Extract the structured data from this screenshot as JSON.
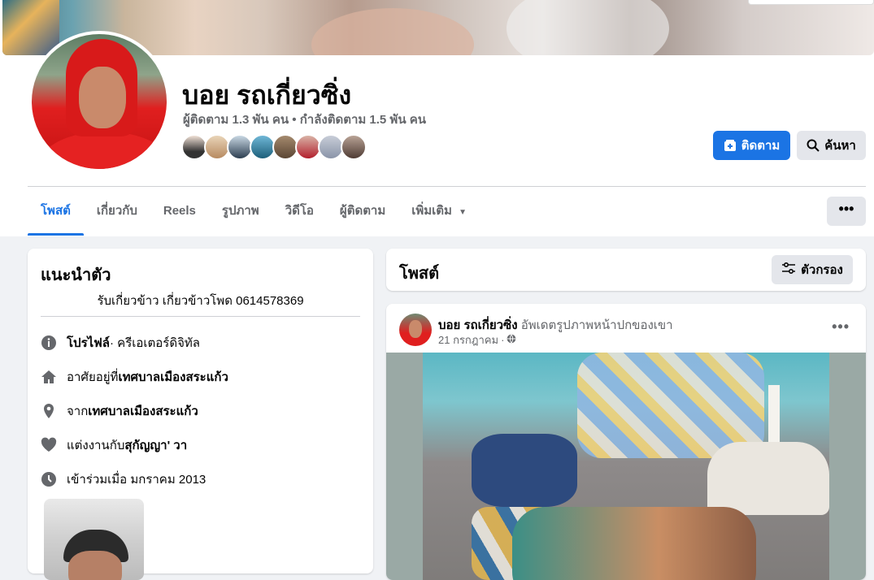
{
  "profile": {
    "name": "บอย รถเกี่ยวซิ่ง",
    "stats": "ผู้ติดตาม 1.3 พัน คน • กำลังติดตาม 1.5 พัน คน"
  },
  "actions": {
    "follow_label": "ติดตาม",
    "search_label": "ค้นหา"
  },
  "tabs": [
    {
      "label": "โพสต์",
      "active": true
    },
    {
      "label": "เกี่ยวกับ",
      "active": false
    },
    {
      "label": "Reels",
      "active": false
    },
    {
      "label": "รูปภาพ",
      "active": false
    },
    {
      "label": "วิดีโอ",
      "active": false
    },
    {
      "label": "ผู้ติดตาม",
      "active": false
    },
    {
      "label": "เพิ่มเติม",
      "active": false
    }
  ],
  "more_menu_label": "•••",
  "intro": {
    "title": "แนะนำตัว",
    "bio": "รับเกี่ยวข้าว เกี่ยวข้าวโพด 0614578369",
    "rows": [
      {
        "icon": "info-icon",
        "prefix": "",
        "bold": "โปรไฟล์",
        "suffix": " · ครีเอเตอร์ดิจิทัล"
      },
      {
        "icon": "home-icon",
        "prefix": "อาศัยอยู่ที่ ",
        "bold": "เทศบาลเมืองสระแก้ว",
        "suffix": ""
      },
      {
        "icon": "location-pin-icon",
        "prefix": "จาก ",
        "bold": "เทศบาลเมืองสระแก้ว",
        "suffix": ""
      },
      {
        "icon": "heart-icon",
        "prefix": "แต่งงานกับ ",
        "bold": "สุกัญญา' วา",
        "suffix": ""
      },
      {
        "icon": "clock-icon",
        "prefix": "เข้าร่วมเมื่อ มกราคม 2013",
        "bold": "",
        "suffix": ""
      }
    ]
  },
  "posts": {
    "title": "โพสต์",
    "filter_label": "ตัวกรอง"
  },
  "post": {
    "author": "บอย รถเกี่ยวซิ่ง",
    "action": "อัพเดตรูปภาพหน้าปกของเขา",
    "date": "21 กรกฎาคม",
    "separator": "·",
    "menu": "•••"
  },
  "colors": {
    "accent": "#1b74e4",
    "secondary_text": "#65676b",
    "button_gray": "#e4e6eb",
    "background": "#f0f2f5"
  }
}
